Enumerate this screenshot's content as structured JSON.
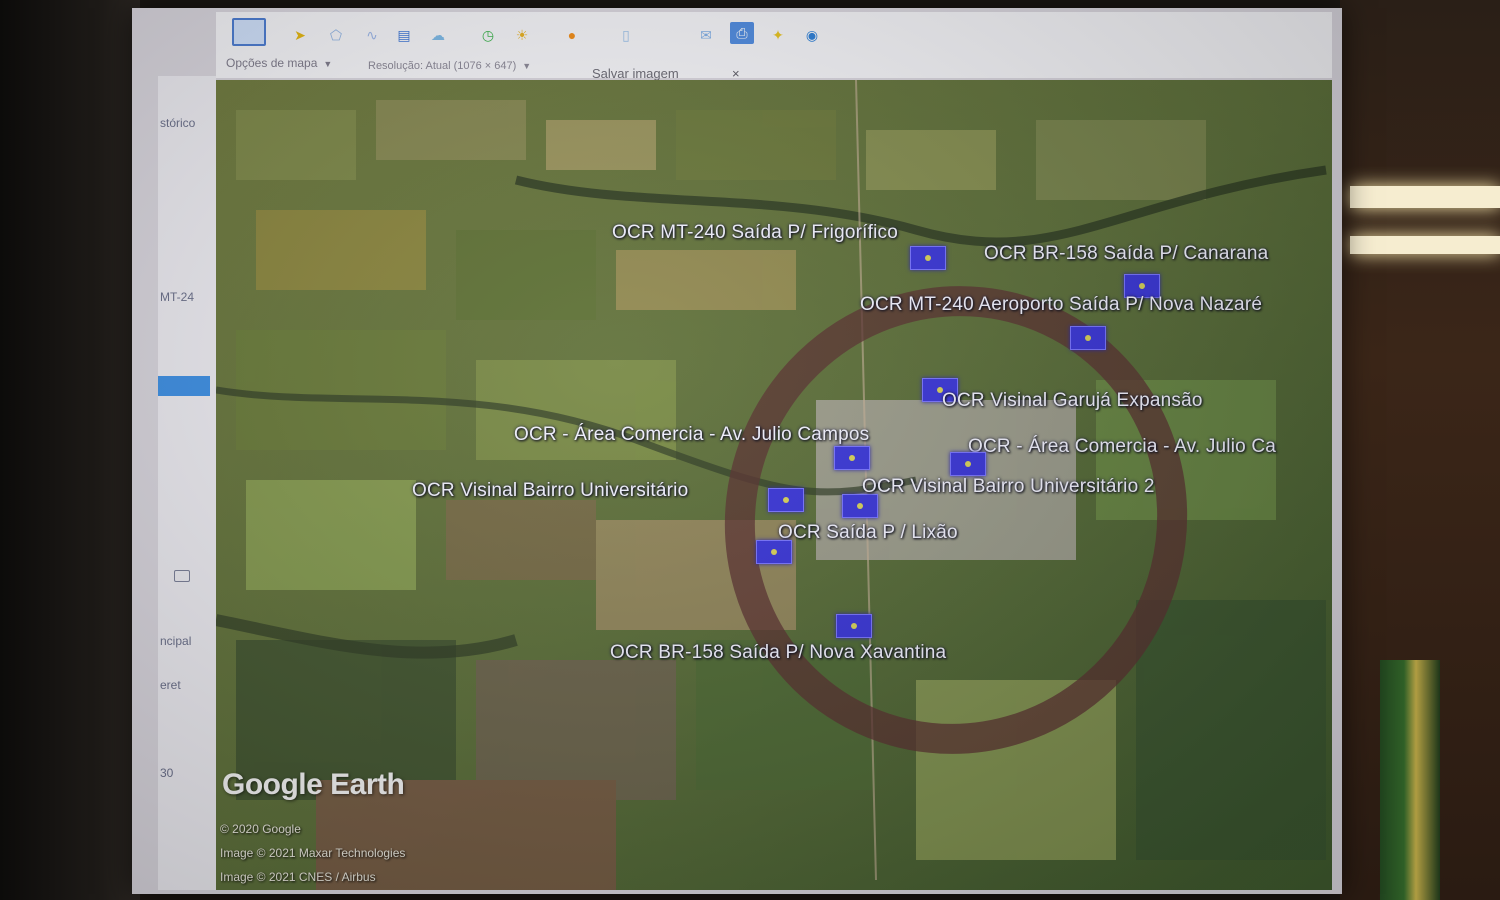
{
  "sidebar": {
    "labels": [
      "stórico",
      "MT-24",
      "ncipal",
      "eret",
      "30"
    ]
  },
  "toolbar": {
    "icons": [
      "view-icon",
      "placemark-icon",
      "polygon-icon",
      "path-icon",
      "image-overlay-icon",
      "tour-icon",
      "historical-imagery-icon",
      "sun-icon",
      "planets-icon",
      "ruler-icon",
      "email-icon",
      "print-icon",
      "save-icon",
      "earth-icon"
    ],
    "map_options_label": "Opções de mapa",
    "resolution_label": "Resolução: Atual (1076 × 647)",
    "save_image_label": "Salvar imagem",
    "close_label": "×"
  },
  "map": {
    "placemarks": [
      {
        "label": "OCR MT-240  Saída P/  Frigorífico"
      },
      {
        "label": "OCR BR-158   Saída P/ Canarana"
      },
      {
        "label": "OCR MT-240   Aeroporto Saída P/ Nova Nazaré"
      },
      {
        "label": "OCR Visinal Garujá Expansão"
      },
      {
        "label": "OCR - Área Comercia  -  Av.  Julio Campos"
      },
      {
        "label": "OCR  - Área Comercia  -  Av.  Julio Ca"
      },
      {
        "label": "OCR Visinal Bairro Universitário"
      },
      {
        "label": "OCR Visinal Bairro Universitário 2"
      },
      {
        "label": "OCR Saída P / Lixão"
      },
      {
        "label": "OCR BR-158   Saída P/ Nova Xavantina"
      }
    ],
    "logo": "Google Earth",
    "credits": [
      "© 2020 Google",
      "Image © 2021 Maxar Technologies",
      "Image © 2021 CNES / Airbus"
    ]
  },
  "colors": {
    "marker": "#3a36d8",
    "label_text": "#f2f2ff",
    "ring": "#5a3030"
  }
}
